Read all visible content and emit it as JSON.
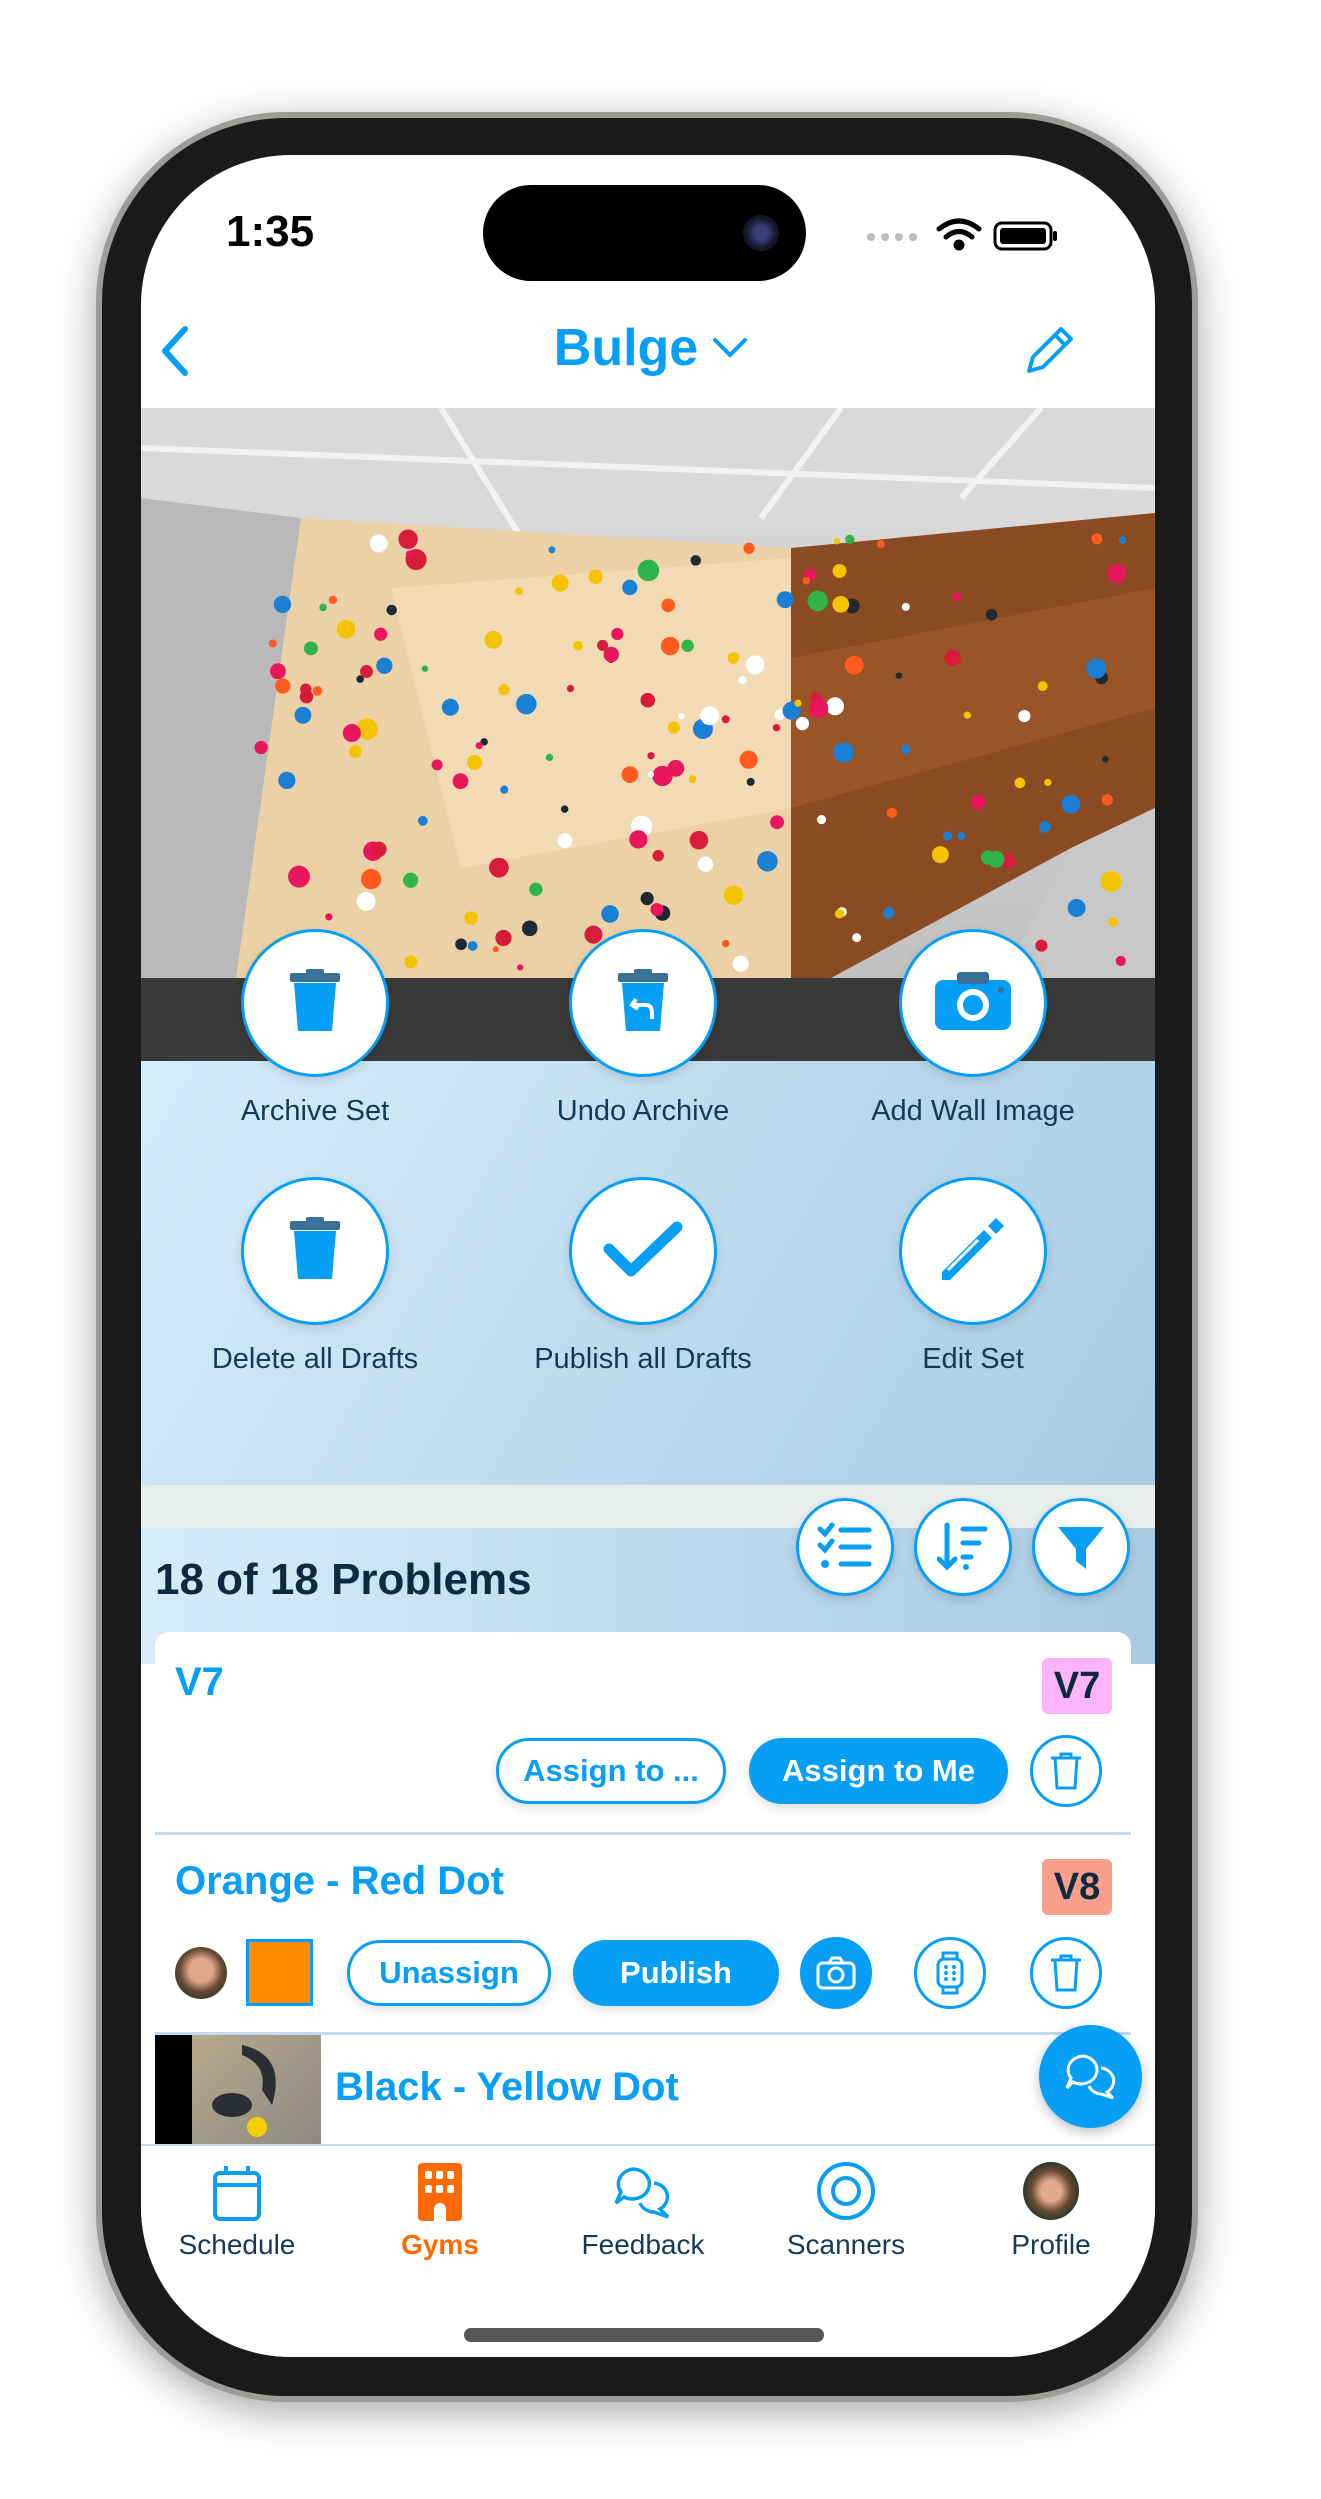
{
  "status": {
    "time": "1:35"
  },
  "nav": {
    "title": "Bulge",
    "back_icon": "chevron-left-icon",
    "edit_icon": "pencil-icon"
  },
  "actions": [
    {
      "label": "Archive Set",
      "icon": "trash-icon"
    },
    {
      "label": "Undo Archive",
      "icon": "undo-trash-icon"
    },
    {
      "label": "Add Wall Image",
      "icon": "camera-icon"
    },
    {
      "label": "Delete all Drafts",
      "icon": "trash-icon"
    },
    {
      "label": "Publish all Drafts",
      "icon": "checkmark-icon"
    },
    {
      "label": "Edit Set",
      "icon": "pencil-icon"
    }
  ],
  "list": {
    "count_label": "18 of 18 Problems",
    "problems": [
      {
        "title": "V7",
        "grade": "V7",
        "grade_color": "#fcb4fb",
        "assign_other": "Assign to ...",
        "assign_me": "Assign to Me"
      },
      {
        "title": "Orange - Red Dot",
        "grade": "V8",
        "grade_color": "#f9a08d",
        "hold_color": "#ff8c00",
        "unassign": "Unassign",
        "publish": "Publish"
      },
      {
        "title": "Black - Yellow Dot"
      }
    ]
  },
  "tabs": [
    {
      "label": "Schedule",
      "icon": "calendar-icon"
    },
    {
      "label": "Gyms",
      "icon": "building-icon",
      "active": true
    },
    {
      "label": "Feedback",
      "icon": "chat-bubbles-icon"
    },
    {
      "label": "Scanners",
      "icon": "target-icon"
    },
    {
      "label": "Profile",
      "icon": "avatar"
    }
  ],
  "colors": {
    "accent": "#069ff5",
    "active_tab": "#ff6a00",
    "text_dark": "#163a55"
  }
}
